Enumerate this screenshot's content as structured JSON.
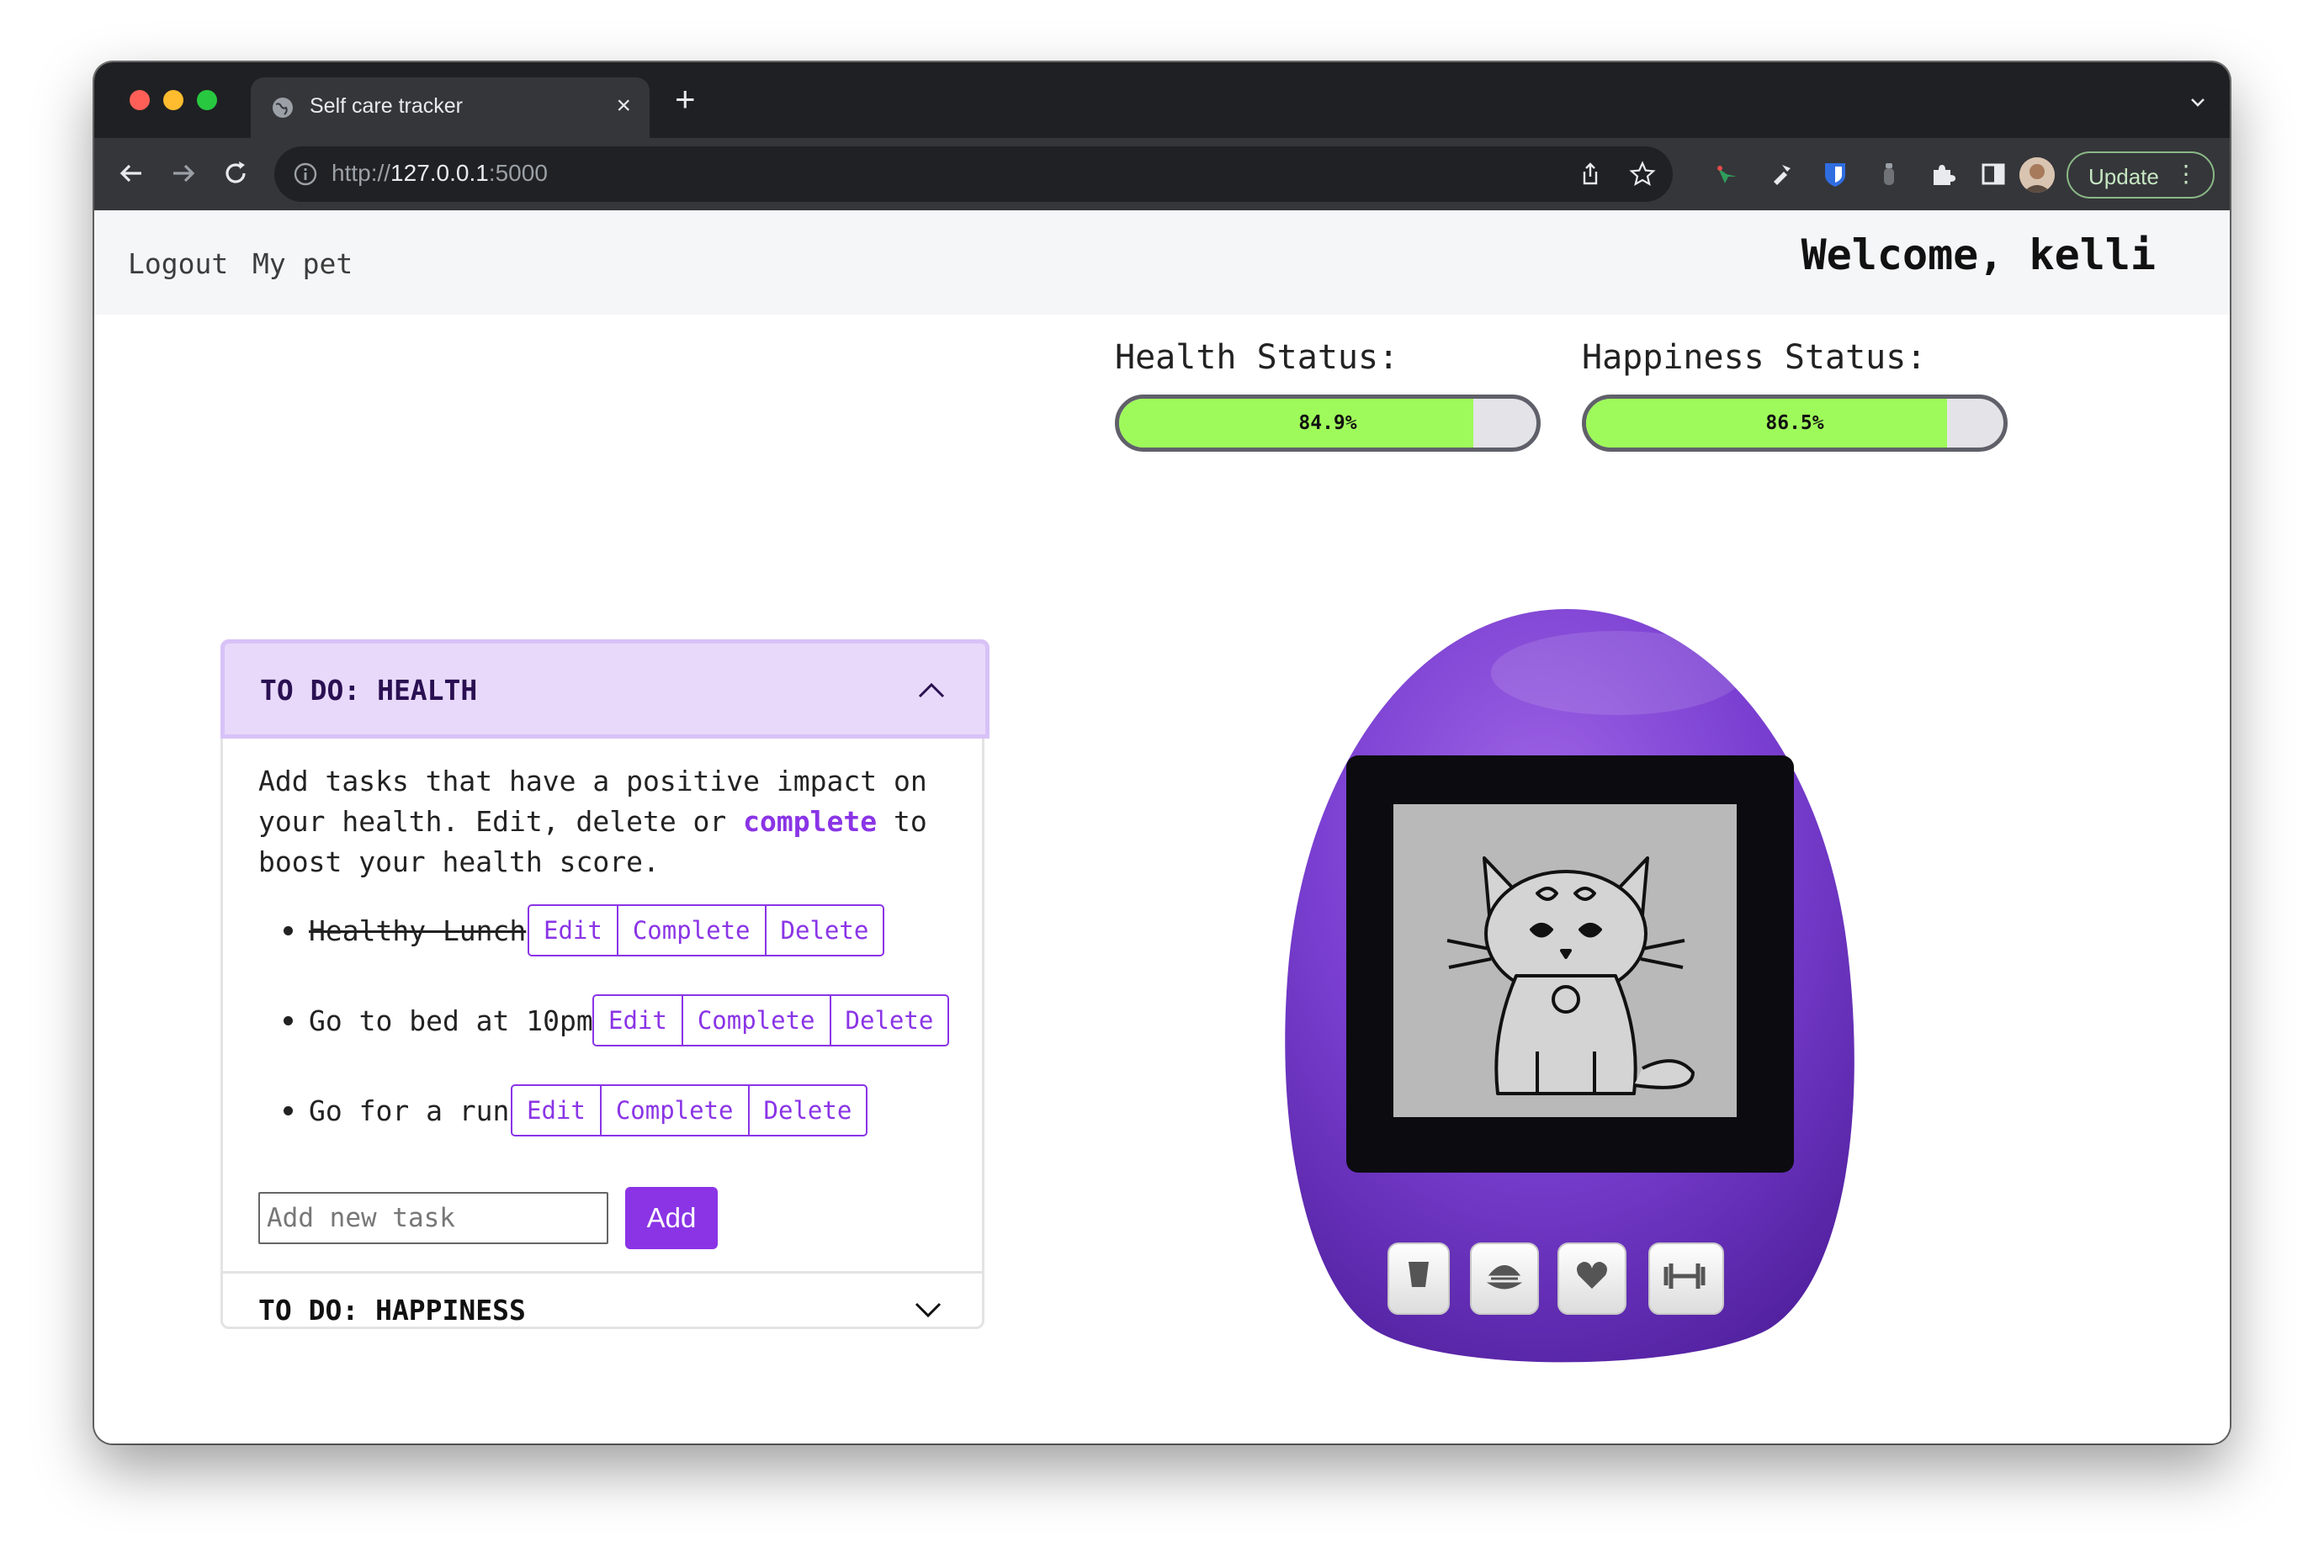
{
  "browser": {
    "tab_title": "Self care tracker",
    "tab_close": "×",
    "new_tab": "+",
    "url_scheme": "http://",
    "url_host": "127.0.0.1",
    "url_port": ":5000",
    "update_label": "Update",
    "menu_glyph": "⋮",
    "icons": [
      "back-icon",
      "forward-icon",
      "reload-icon",
      "info-icon",
      "share-icon",
      "star-icon",
      "extension-icons",
      "puzzle-icon",
      "sidebar-icon",
      "avatar",
      "chevron-down-icon"
    ]
  },
  "header": {
    "nav": [
      "Logout",
      "My pet"
    ],
    "welcome": "Welcome, kelli"
  },
  "status": {
    "health": {
      "label": "Health Status:",
      "value": 84.9,
      "text": "84.9%"
    },
    "happiness": {
      "label": "Happiness Status:",
      "value": 86.5,
      "text": "86.5%"
    },
    "fill_color": "#9efa5a"
  },
  "todo_health": {
    "title": "TO DO: HEALTH",
    "description_pre": "Add tasks that have a positive impact on your health. Edit, delete or ",
    "description_highlight": "complete",
    "description_post": " to boost your health score.",
    "tasks": [
      {
        "text": "Healthy Lunch",
        "done": true
      },
      {
        "text": "Go to bed at 10pm",
        "done": false
      },
      {
        "text": "Go for a run",
        "done": false
      }
    ],
    "actions": [
      "Edit",
      "Complete",
      "Delete"
    ],
    "input_placeholder": "Add new task",
    "add_label": "Add"
  },
  "todo_happiness": {
    "title": "TO DO: HAPPINESS"
  },
  "pet": {
    "body_color": "#7a3fd1",
    "screen_bg": "#b9b9b9",
    "buttons": [
      "drink-icon",
      "food-icon",
      "heart-icon",
      "dumbbell-icon"
    ]
  },
  "colors": {
    "accent": "#8a34e6",
    "accordion_header": "#e8d9fb"
  }
}
